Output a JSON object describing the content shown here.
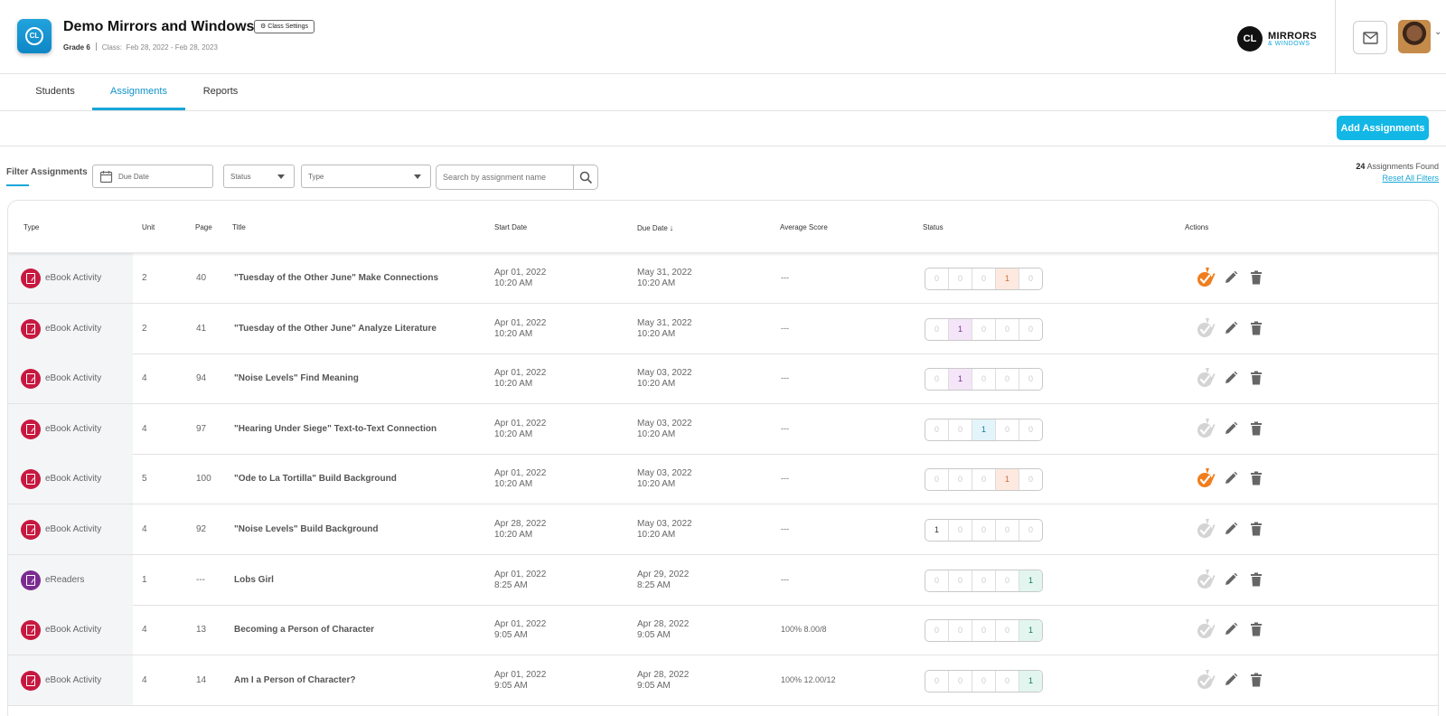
{
  "header": {
    "logo_text": "CL",
    "class_title": "Demo Mirrors and Windows",
    "settings_label": "Class Settings",
    "grade": "Grade 6",
    "class_label": "Class:",
    "class_dates": "Feb 28, 2022 - Feb 28, 2023",
    "brand_badge": "CL",
    "brand_line1": "MIRRORS",
    "brand_line2": "& WINDOWS"
  },
  "tabs": [
    {
      "label": "Students"
    },
    {
      "label": "Assignments",
      "active": true
    },
    {
      "label": "Reports"
    }
  ],
  "toolbar": {
    "add_label": "Add Assignments"
  },
  "filters": {
    "label": "Filter Assignments",
    "due_date": "Due Date",
    "status": "Status",
    "type": "Type",
    "search_placeholder": "Search by assignment name",
    "count": "24",
    "found_text": "Assignments Found",
    "reset": "Reset All Filters"
  },
  "table": {
    "columns": {
      "type": "Type",
      "unit": "Unit",
      "page": "Page",
      "title": "Title",
      "start": "Start Date",
      "due": "Due Date",
      "score": "Average Score",
      "status": "Status",
      "actions": "Actions"
    },
    "rows": [
      {
        "type": "eBook Activity",
        "unit": "2",
        "page": "40",
        "title": "\"Tuesday of the Other June\" Make Connections",
        "start_date": "Apr 01, 2022",
        "start_time": "10:20 AM",
        "due_date": "May 31, 2022",
        "due_time": "10:20 AM",
        "score": "---",
        "status": [
          "0",
          "0",
          "0",
          "1",
          "0"
        ],
        "grade_active": true
      },
      {
        "type": "eBook Activity",
        "unit": "2",
        "page": "41",
        "title": "\"Tuesday of the Other June\" Analyze Literature",
        "start_date": "Apr 01, 2022",
        "start_time": "10:20 AM",
        "due_date": "May 31, 2022",
        "due_time": "10:20 AM",
        "score": "---",
        "status": [
          "0",
          "1",
          "0",
          "0",
          "0"
        ],
        "grade_active": false
      },
      {
        "type": "eBook Activity",
        "unit": "4",
        "page": "94",
        "title": "\"Noise Levels\" Find Meaning",
        "start_date": "Apr 01, 2022",
        "start_time": "10:20 AM",
        "due_date": "May 03, 2022",
        "due_time": "10:20 AM",
        "score": "---",
        "status": [
          "0",
          "1",
          "0",
          "0",
          "0"
        ],
        "grade_active": false
      },
      {
        "type": "eBook Activity",
        "unit": "4",
        "page": "97",
        "title": "\"Hearing Under Siege\" Text-to-Text Connection",
        "start_date": "Apr 01, 2022",
        "start_time": "10:20 AM",
        "due_date": "May 03, 2022",
        "due_time": "10:20 AM",
        "score": "---",
        "status": [
          "0",
          "0",
          "1",
          "0",
          "0"
        ],
        "grade_active": false
      },
      {
        "type": "eBook Activity",
        "unit": "5",
        "page": "100",
        "title": "\"Ode to La Tortilla\" Build Background",
        "start_date": "Apr 01, 2022",
        "start_time": "10:20 AM",
        "due_date": "May 03, 2022",
        "due_time": "10:20 AM",
        "score": "---",
        "status": [
          "0",
          "0",
          "0",
          "1",
          "0"
        ],
        "grade_active": true
      },
      {
        "type": "eBook Activity",
        "unit": "4",
        "page": "92",
        "title": "\"Noise Levels\" Build Background",
        "start_date": "Apr 28, 2022",
        "start_time": "10:20 AM",
        "due_date": "May 03, 2022",
        "due_time": "10:20 AM",
        "score": "---",
        "status": [
          "1",
          "0",
          "0",
          "0",
          "0"
        ],
        "grade_active": false
      },
      {
        "type": "eReaders",
        "unit": "1",
        "page": "---",
        "title": "Lobs Girl",
        "start_date": "Apr 01, 2022",
        "start_time": "8:25 AM",
        "due_date": "Apr 29, 2022",
        "due_time": "8:25 AM",
        "score": "---",
        "status": [
          "0",
          "0",
          "0",
          "0",
          "1"
        ],
        "grade_active": false,
        "reader": true
      },
      {
        "type": "eBook Activity",
        "unit": "4",
        "page": "13",
        "title": "Becoming a Person of Character",
        "start_date": "Apr 01, 2022",
        "start_time": "9:05 AM",
        "due_date": "Apr 28, 2022",
        "due_time": "9:05 AM",
        "score": "100% 8.00/8",
        "status": [
          "0",
          "0",
          "0",
          "0",
          "1"
        ],
        "grade_active": false
      },
      {
        "type": "eBook Activity",
        "unit": "4",
        "page": "14",
        "title": "Am I a Person of Character?",
        "start_date": "Apr 01, 2022",
        "start_time": "9:05 AM",
        "due_date": "Apr 28, 2022",
        "due_time": "9:05 AM",
        "score": "100% 12.00/12",
        "status": [
          "0",
          "0",
          "0",
          "0",
          "1"
        ],
        "grade_active": false
      }
    ]
  },
  "colors": {
    "accent": "#18a7d8",
    "ebook_icon": "#c7183f",
    "reader_icon": "#7a2c91",
    "grade_active": "#f07d1e",
    "grade_inactive": "#d4d4d4"
  }
}
